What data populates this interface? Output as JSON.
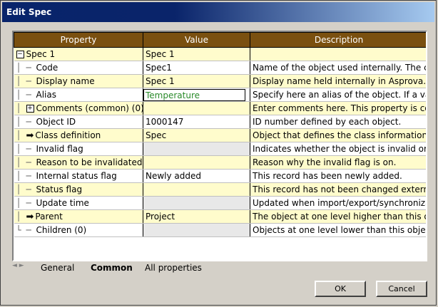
{
  "window": {
    "title": "Edit Spec"
  },
  "grid": {
    "headers": [
      "Property",
      "Value",
      "Description"
    ],
    "rows": [
      {
        "prop": "Spec 1",
        "value": "Spec 1",
        "desc": "",
        "style": "y",
        "icon": "minus",
        "indent": 0
      },
      {
        "prop": "Code",
        "value": "Spec1",
        "desc": "Name of the object used internally. The co",
        "style": "w",
        "icon": "line",
        "indent": 1
      },
      {
        "prop": "Display name",
        "value": "Spec 1",
        "desc": "Display name held internally in Asprova. If",
        "style": "y",
        "icon": "line",
        "indent": 1
      },
      {
        "prop": "Alias",
        "value": "Temperature",
        "desc": "Specify here an alias of the object. If a valu",
        "style": "w",
        "icon": "line",
        "indent": 1,
        "editing": true
      },
      {
        "prop": "Comments (common) (0)",
        "value": "",
        "desc": "Enter comments here. This property is co",
        "style": "y",
        "icon": "plus",
        "indent": 1
      },
      {
        "prop": "Object ID",
        "value": "1000147",
        "desc": "ID number defined by each object.",
        "style": "w",
        "icon": "line",
        "indent": 1
      },
      {
        "prop": "Class definition",
        "value": "Spec",
        "desc": "Object that defines the class information of",
        "style": "y",
        "icon": "arrow",
        "indent": 1
      },
      {
        "prop": "Invalid flag",
        "value": "",
        "desc": "Indicates whether the object is invalid or n",
        "style": "w",
        "icon": "line",
        "indent": 1
      },
      {
        "prop": "Reason to be invalidated",
        "value": "",
        "desc": "Reason why the invalid flag is on.",
        "style": "y",
        "icon": "line",
        "indent": 1
      },
      {
        "prop": "Internal status flag",
        "value": "Newly added",
        "desc": "This record has been newly added.",
        "style": "w",
        "icon": "line",
        "indent": 1
      },
      {
        "prop": "Status flag",
        "value": "",
        "desc": "This record has not been changed external",
        "style": "y",
        "icon": "line",
        "indent": 1
      },
      {
        "prop": "Update time",
        "value": "",
        "desc": "Updated when import/export/synchronizati",
        "style": "w",
        "icon": "line",
        "indent": 1
      },
      {
        "prop": "Parent",
        "value": "Project",
        "desc": "The object at one level higher than this obj",
        "style": "y",
        "icon": "arrow",
        "indent": 1
      },
      {
        "prop": "Children (0)",
        "value": "",
        "desc": "Objects at one level lower than this object.",
        "style": "w",
        "icon": "corner",
        "indent": 1
      }
    ]
  },
  "tabs": {
    "labels": [
      "General",
      "Common",
      "All properties"
    ],
    "active": "Common"
  },
  "buttons": {
    "ok": "OK",
    "cancel": "Cancel"
  }
}
